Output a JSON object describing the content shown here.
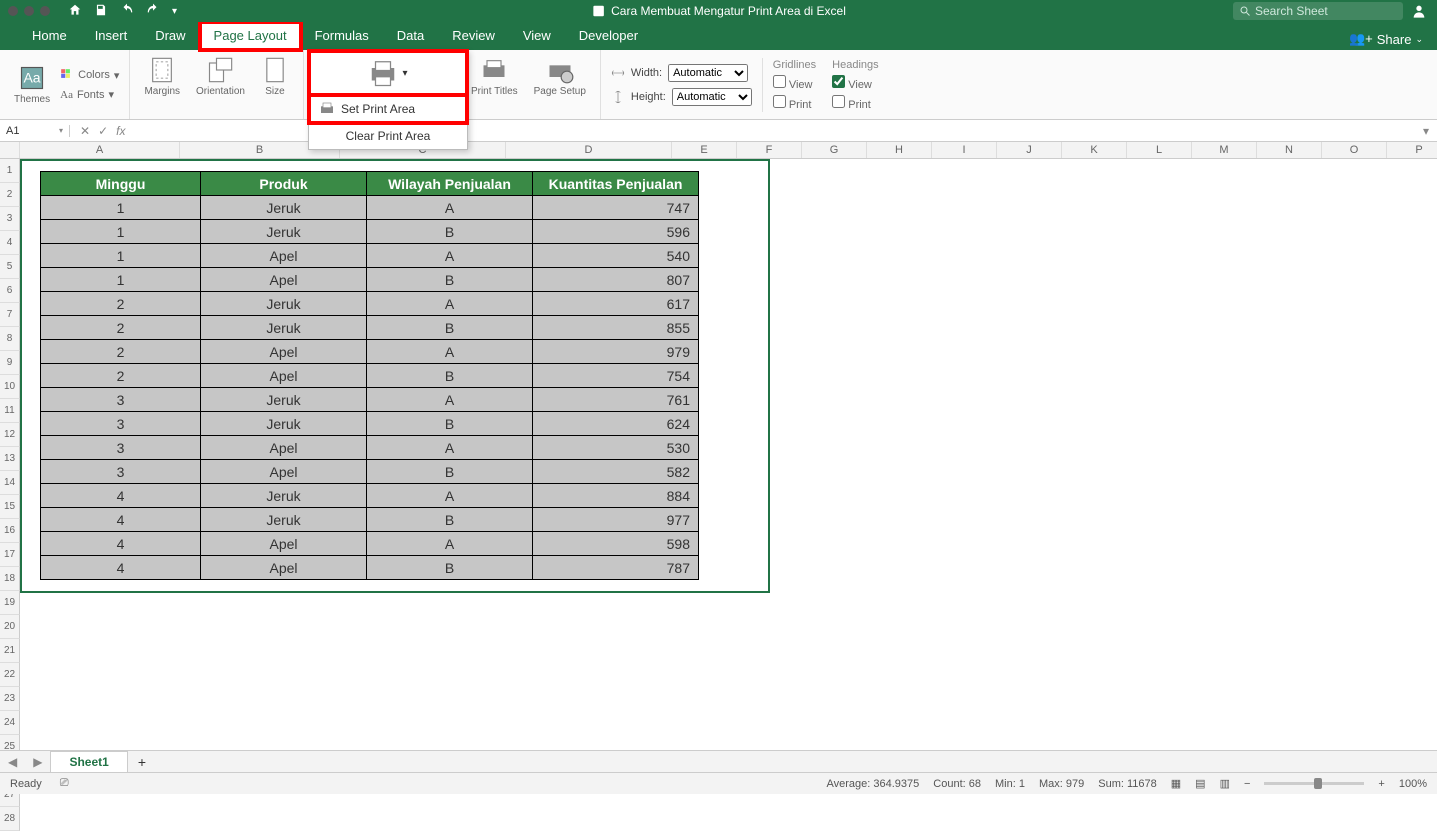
{
  "title": "Cara Membuat Mengatur Print Area di Excel",
  "search_placeholder": "Search Sheet",
  "tabs": [
    "Home",
    "Insert",
    "Draw",
    "Page Layout",
    "Formulas",
    "Data",
    "Review",
    "View",
    "Developer"
  ],
  "active_tab": "Page Layout",
  "share_label": "Share",
  "ribbon": {
    "themes": "Themes",
    "colors": "Colors",
    "fonts": "Fonts",
    "margins": "Margins",
    "orientation": "Orientation",
    "size": "Size",
    "print_titles": "Print Titles",
    "page_setup": "Page Setup",
    "width_label": "Width:",
    "height_label": "Height:",
    "width_val": "Automatic",
    "height_val": "Automatic",
    "gridlines": "Gridlines",
    "headings": "Headings",
    "view": "View",
    "print": "Print"
  },
  "dropdown": {
    "set": "Set Print Area",
    "clear": "Clear Print Area"
  },
  "name_box": "A1",
  "columns": [
    "A",
    "B",
    "C",
    "D",
    "E",
    "F",
    "G",
    "H",
    "I",
    "J",
    "K",
    "L",
    "M",
    "N",
    "O",
    "P"
  ],
  "row_count": 28,
  "headers": [
    "Minggu",
    "Produk",
    "Wilayah Penjualan",
    "Kuantitas Penjualan"
  ],
  "rows": [
    [
      "1",
      "Jeruk",
      "A",
      "747"
    ],
    [
      "1",
      "Jeruk",
      "B",
      "596"
    ],
    [
      "1",
      "Apel",
      "A",
      "540"
    ],
    [
      "1",
      "Apel",
      "B",
      "807"
    ],
    [
      "2",
      "Jeruk",
      "A",
      "617"
    ],
    [
      "2",
      "Jeruk",
      "B",
      "855"
    ],
    [
      "2",
      "Apel",
      "A",
      "979"
    ],
    [
      "2",
      "Apel",
      "B",
      "754"
    ],
    [
      "3",
      "Jeruk",
      "A",
      "761"
    ],
    [
      "3",
      "Jeruk",
      "B",
      "624"
    ],
    [
      "3",
      "Apel",
      "A",
      "530"
    ],
    [
      "3",
      "Apel",
      "B",
      "582"
    ],
    [
      "4",
      "Jeruk",
      "A",
      "884"
    ],
    [
      "4",
      "Jeruk",
      "B",
      "977"
    ],
    [
      "4",
      "Apel",
      "A",
      "598"
    ],
    [
      "4",
      "Apel",
      "B",
      "787"
    ]
  ],
  "sheet_name": "Sheet1",
  "status": {
    "ready": "Ready",
    "average_label": "Average:",
    "average": "364.9375",
    "count_label": "Count:",
    "count": "68",
    "min_label": "Min:",
    "min": "1",
    "max_label": "Max:",
    "max": "979",
    "sum_label": "Sum:",
    "sum": "11678",
    "zoom": "100%"
  }
}
